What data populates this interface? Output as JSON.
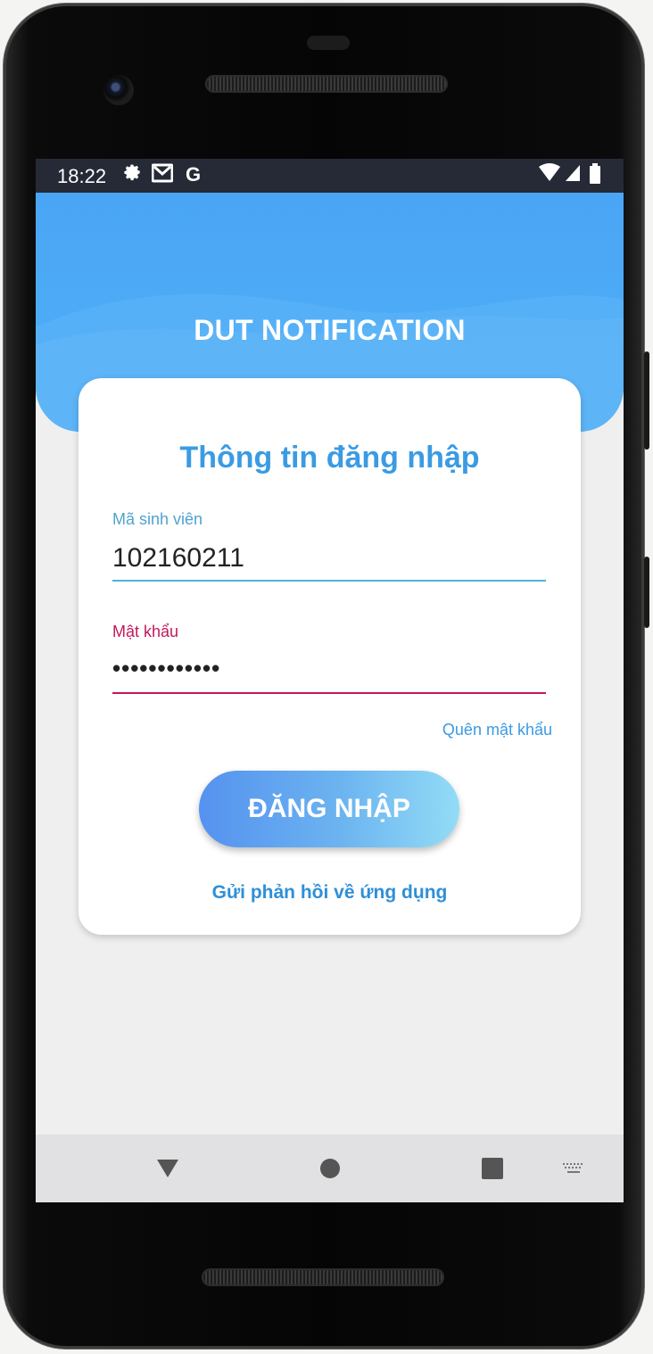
{
  "status_bar": {
    "time": "18:22",
    "icons": [
      "gear-icon",
      "gmail-icon",
      "google-icon",
      "wifi-icon",
      "signal-icon",
      "battery-icon"
    ],
    "google_letter": "G"
  },
  "header": {
    "app_title": "DUT NOTIFICATION"
  },
  "login_card": {
    "title": "Thông tin đăng nhập",
    "student_id": {
      "label": "Mã sinh viên",
      "value": "102160211"
    },
    "password": {
      "label": "Mật khẩu",
      "value": "••••••••••••"
    },
    "forgot_password": "Quên mật khẩu",
    "login_button": "ĐĂNG NHẬP",
    "feedback_link": "Gửi phản hồi về ứng dụng"
  },
  "navigation": {
    "buttons": [
      "back-icon",
      "home-icon",
      "recents-icon",
      "keyboard-icon"
    ]
  },
  "colors": {
    "header_blue": "#4aa6f5",
    "title_blue": "#3a9be3",
    "student_id_accent": "#4fb3d6",
    "password_accent": "#c2185b",
    "status_bar": "#262a36",
    "background": "#efefef"
  }
}
